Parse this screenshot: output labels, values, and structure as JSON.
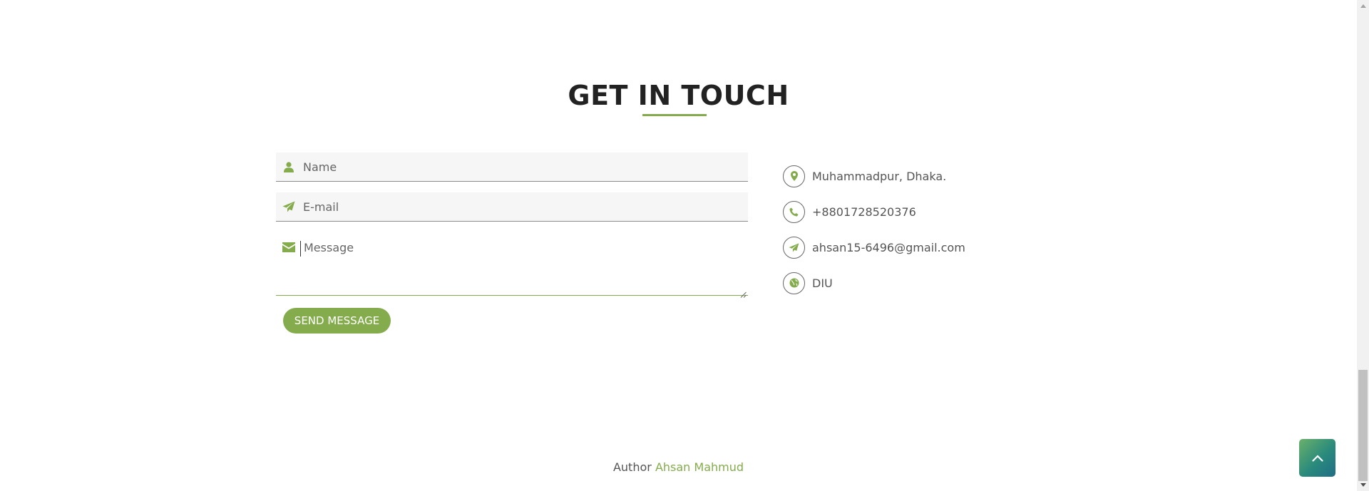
{
  "section": {
    "title": "GET IN TOUCH"
  },
  "form": {
    "name_placeholder": "Name",
    "email_placeholder": "E-mail",
    "message_placeholder": "Message",
    "name_value": "",
    "email_value": "",
    "message_value": "",
    "send_label": "SEND MESSAGE",
    "icons": {
      "name": "user-icon",
      "email": "paper-plane-icon",
      "message": "envelope-icon"
    }
  },
  "contact_info": [
    {
      "icon": "map-marker-icon",
      "text": "Muhammadpur, Dhaka."
    },
    {
      "icon": "phone-icon",
      "text": "+8801728520376"
    },
    {
      "icon": "paper-plane-icon",
      "text": "ahsan15-6496@gmail.com"
    },
    {
      "icon": "globe-icon",
      "text": "DIU"
    }
  ],
  "footer": {
    "prefix": "Author",
    "author": "Ahsan Mahmud"
  },
  "colors": {
    "accent": "#84ac4c",
    "heading": "#222222",
    "text": "#555555",
    "field_bg": "#f6f6f6"
  }
}
